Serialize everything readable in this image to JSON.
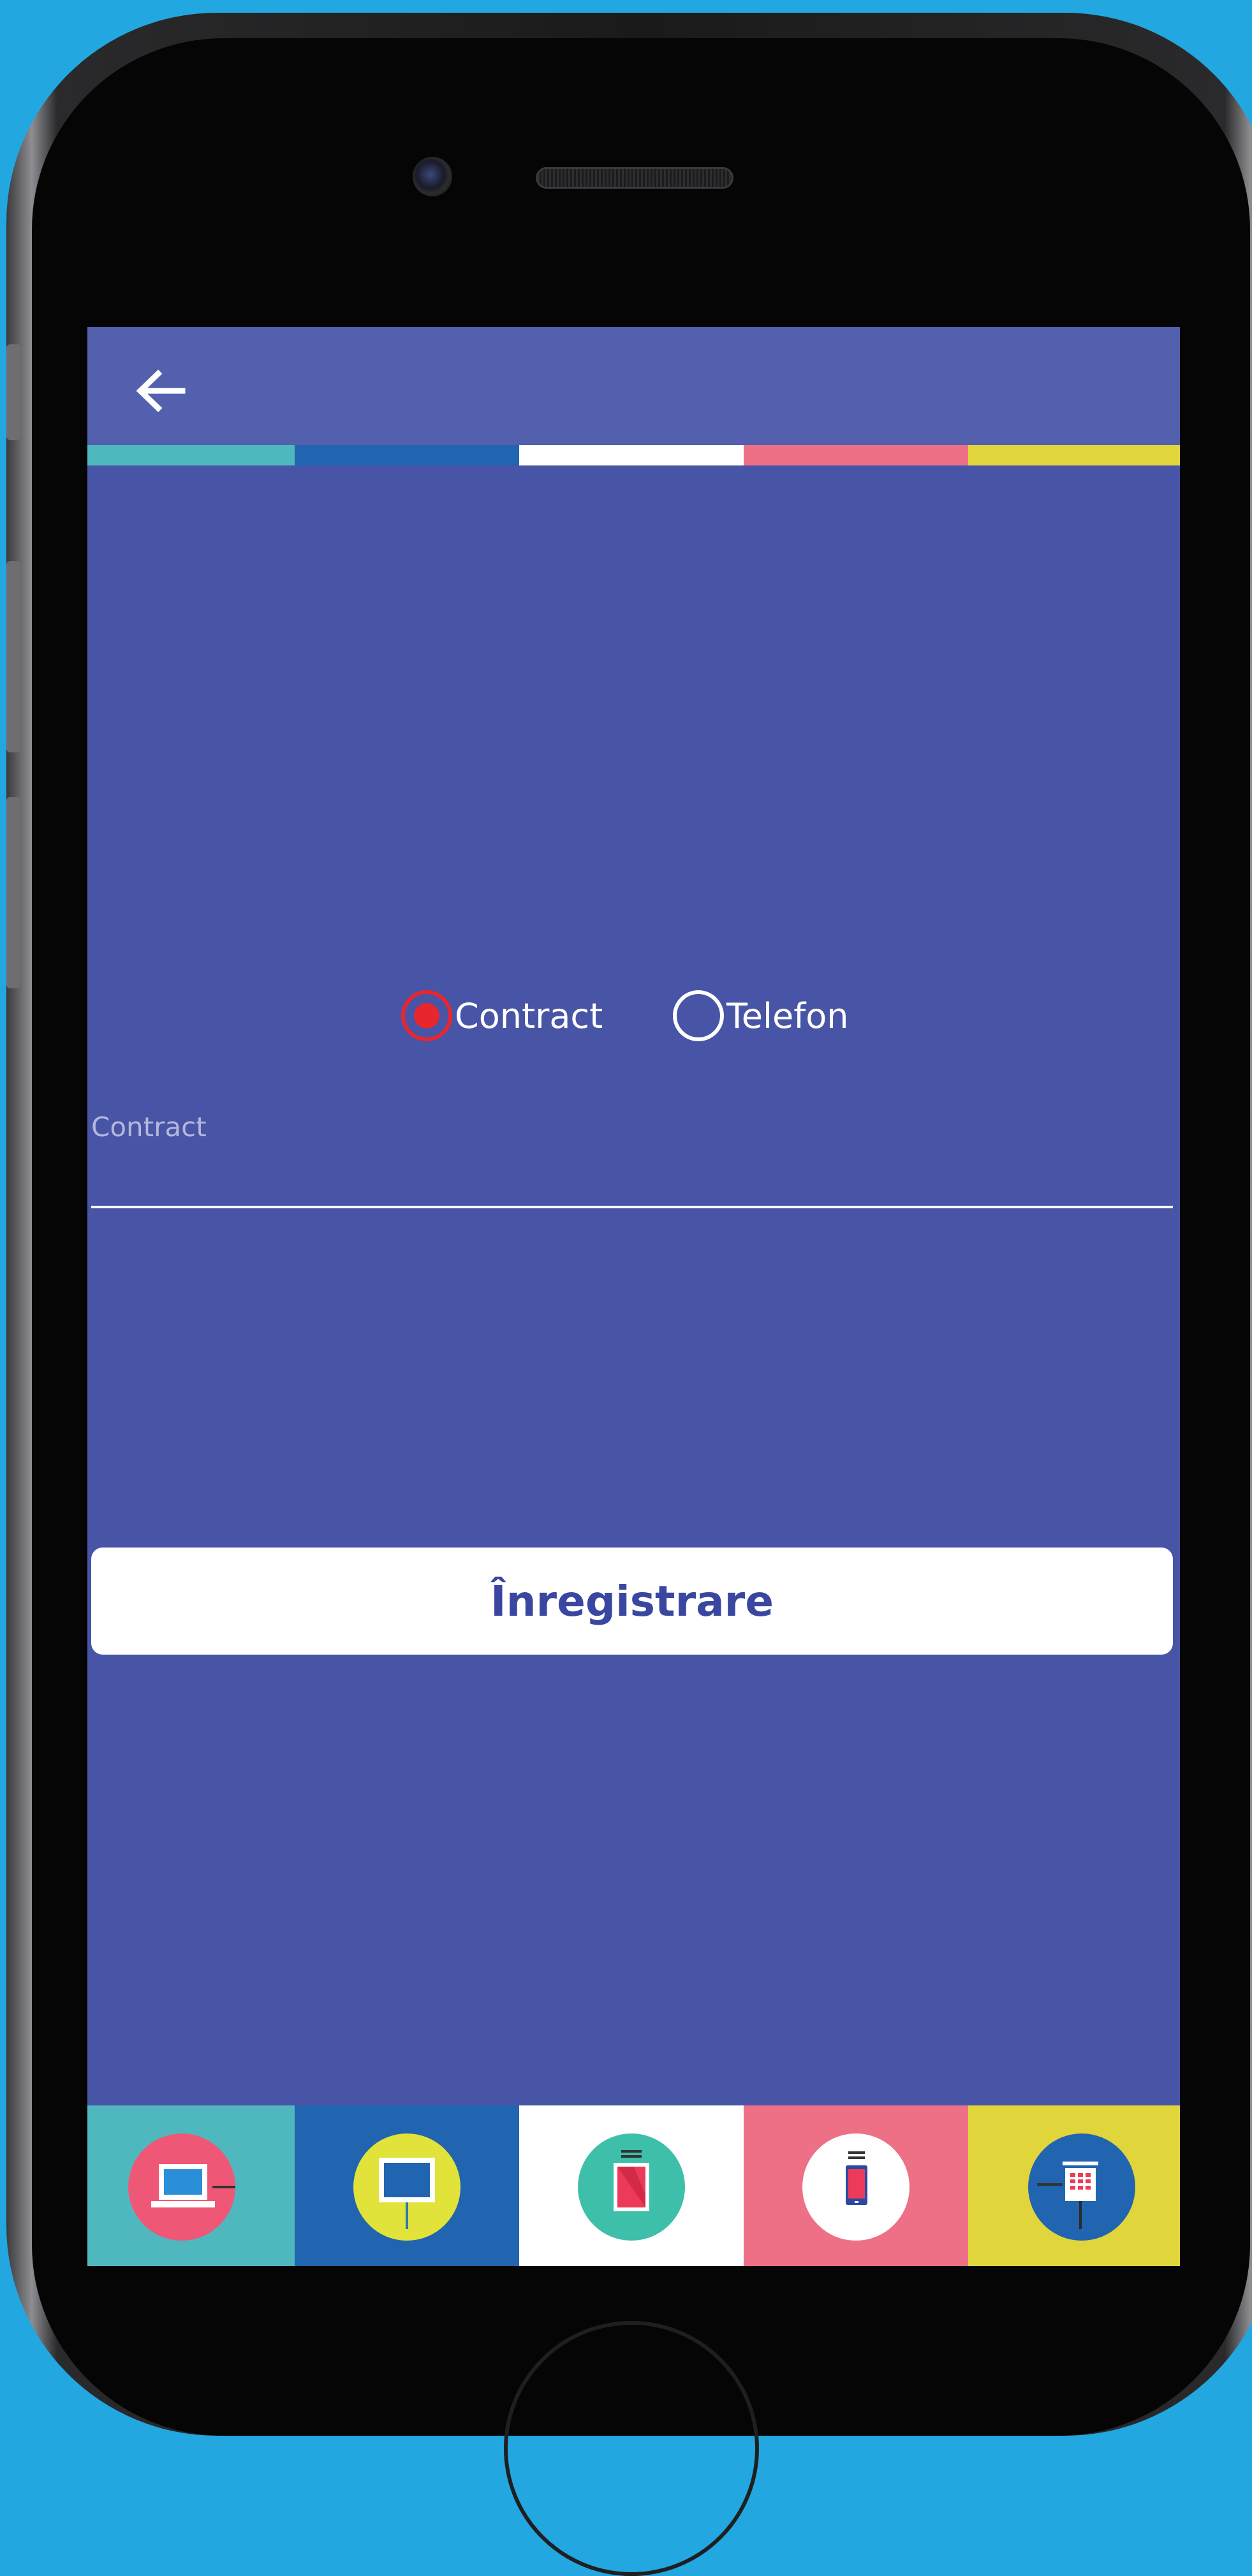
{
  "header": {
    "back_icon": "arrow-left-icon"
  },
  "colors": {
    "background": "#22a7e0",
    "screen": "#4854a6",
    "appbar": "#5260ad",
    "stripe": [
      "#4fb8bf",
      "#2164b0",
      "#ffffff",
      "#ee7086",
      "#e1d53c"
    ],
    "radio_selected": "#e8262e",
    "button_text": "#3a47a0"
  },
  "radio_group": {
    "options": [
      {
        "label": "Contract",
        "selected": true
      },
      {
        "label": "Telefon",
        "selected": false
      }
    ]
  },
  "contract_field": {
    "label": "Contract",
    "value": ""
  },
  "register_button": {
    "label": "Înregistrare"
  },
  "bottom_nav": {
    "items": [
      {
        "icon": "laptop-icon"
      },
      {
        "icon": "tv-monitor-icon"
      },
      {
        "icon": "tablet-icon"
      },
      {
        "icon": "smartphone-icon"
      },
      {
        "icon": "landline-phone-icon"
      }
    ]
  }
}
